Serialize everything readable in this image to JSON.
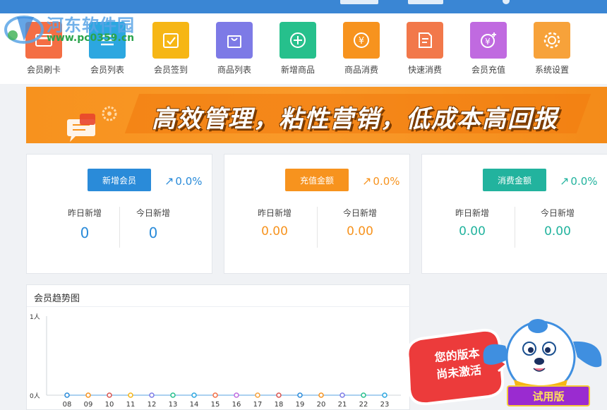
{
  "watermark": {
    "name": "河东软件园",
    "url": "www.pc0359.cn"
  },
  "toolbar": {
    "items": [
      {
        "label": "会员刷卡",
        "color": "#f46e44",
        "icon": "card-swipe-icon"
      },
      {
        "label": "会员列表",
        "color": "#2ca7e0",
        "icon": "list-icon"
      },
      {
        "label": "会员签到",
        "color": "#f6b615",
        "icon": "checkin-icon"
      },
      {
        "label": "商品列表",
        "color": "#7d7ae6",
        "icon": "shopping-bag-icon"
      },
      {
        "label": "新增商品",
        "color": "#26c08c",
        "icon": "plus-circle-icon"
      },
      {
        "label": "商品消费",
        "color": "#f7931e",
        "icon": "yen-coin-icon"
      },
      {
        "label": "快速消费",
        "color": "#f2784a",
        "icon": "quick-note-icon"
      },
      {
        "label": "会员充值",
        "color": "#c06ae0",
        "icon": "yen-recharge-icon"
      },
      {
        "label": "系统设置",
        "color": "#f7a23a",
        "icon": "gear-icon"
      }
    ]
  },
  "banner": {
    "slogan": "高效管理，粘性营销，低成本高回报"
  },
  "cards": [
    {
      "pill": "新增会员",
      "pill_color": "#2a8bd9",
      "pct": "0.0%",
      "accent": "#2a8bd9",
      "left_label": "昨日新增",
      "left_value": "0",
      "right_label": "今日新增",
      "right_value": "0"
    },
    {
      "pill": "充值金额",
      "pill_color": "#f7931e",
      "pct": "0.0%",
      "accent": "#f7931e",
      "left_label": "昨日新增",
      "left_value": "0.00",
      "right_label": "今日新增",
      "right_value": "0.00"
    },
    {
      "pill": "消费金额",
      "pill_color": "#22b39e",
      "pct": "0.0%",
      "accent": "#22b39e",
      "left_label": "昨日新增",
      "left_value": "0.00",
      "right_label": "今日新增",
      "right_value": "0.00"
    }
  ],
  "chart": {
    "title": "会员趋势图",
    "chart_data": {
      "type": "line",
      "x": [
        "08",
        "09",
        "10",
        "11",
        "12",
        "13",
        "14",
        "15",
        "16",
        "17",
        "18",
        "19",
        "20",
        "21",
        "22",
        "23"
      ],
      "values": [
        0,
        0,
        0,
        0,
        0,
        0,
        0,
        0,
        0,
        0,
        0,
        0,
        0,
        0,
        0,
        0
      ],
      "ytick_labels": [
        "1人",
        "0人"
      ],
      "ylim": [
        0,
        1
      ],
      "point_colors": [
        "#2a8bd9",
        "#f7931e",
        "#d9534f",
        "#f6b615",
        "#7d7ae6",
        "#26c08c",
        "#2ca7e0",
        "#f46e44",
        "#c06ae0",
        "#f7a23a",
        "#d9534f",
        "#2a8bd9",
        "#f7931e",
        "#7d7ae6",
        "#26c08c",
        "#2ca7e0"
      ],
      "line_color": "#8fc2ec",
      "grid": false
    }
  },
  "promo": {
    "line1": "您的版本",
    "line2": "尚未激活",
    "trial": "试用版"
  }
}
